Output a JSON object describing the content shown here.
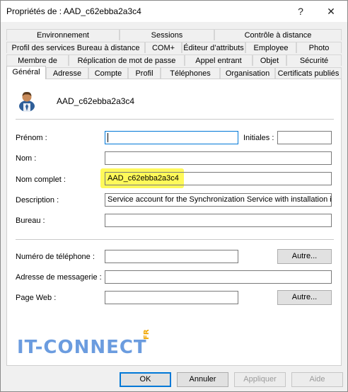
{
  "window": {
    "title": "Propriétés de : AAD_c62ebba2a3c4",
    "help_glyph": "?",
    "close_glyph": "✕"
  },
  "tabs": {
    "row1": [
      "Environnement",
      "Sessions",
      "Contrôle à distance"
    ],
    "row2": [
      "Profil des services Bureau à distance",
      "COM+",
      "Éditeur d’attributs",
      "Employee",
      "Photo"
    ],
    "row3": [
      "Membre de",
      "Réplication de mot de passe",
      "Appel entrant",
      "Objet",
      "Sécurité"
    ],
    "row4": [
      "Général",
      "Adresse",
      "Compte",
      "Profil",
      "Téléphones",
      "Organisation",
      "Certificats publiés"
    ],
    "active": "Général"
  },
  "general": {
    "display_name": "AAD_c62ebba2a3c4",
    "fields": {
      "prenom": {
        "label": "Prénom :",
        "value": ""
      },
      "initiales": {
        "label": "Initiales :",
        "value": ""
      },
      "nom": {
        "label": "Nom :",
        "value": ""
      },
      "nom_complet": {
        "label": "Nom complet :",
        "value": "AAD_c62ebba2a3c4"
      },
      "description": {
        "label": "Description :",
        "value": "Service account for the Synchronization Service with installation ide"
      },
      "bureau": {
        "label": "Bureau :",
        "value": ""
      },
      "telephone": {
        "label": "Numéro de téléphone :",
        "value": "",
        "button": "Autre..."
      },
      "email": {
        "label": "Adresse de messagerie :",
        "value": ""
      },
      "web": {
        "label": "Page Web :",
        "value": "",
        "button": "Autre..."
      }
    }
  },
  "watermark": {
    "text": "IT-CONNECT",
    "suffix": "FR",
    "color": "#3a7bd5",
    "accent": "#f0a500"
  },
  "footer": {
    "ok": "OK",
    "cancel": "Annuler",
    "apply": "Appliquer",
    "help": "Aide"
  },
  "colors": {
    "highlight": "#fff95a",
    "focus_border": "#0078d7"
  }
}
